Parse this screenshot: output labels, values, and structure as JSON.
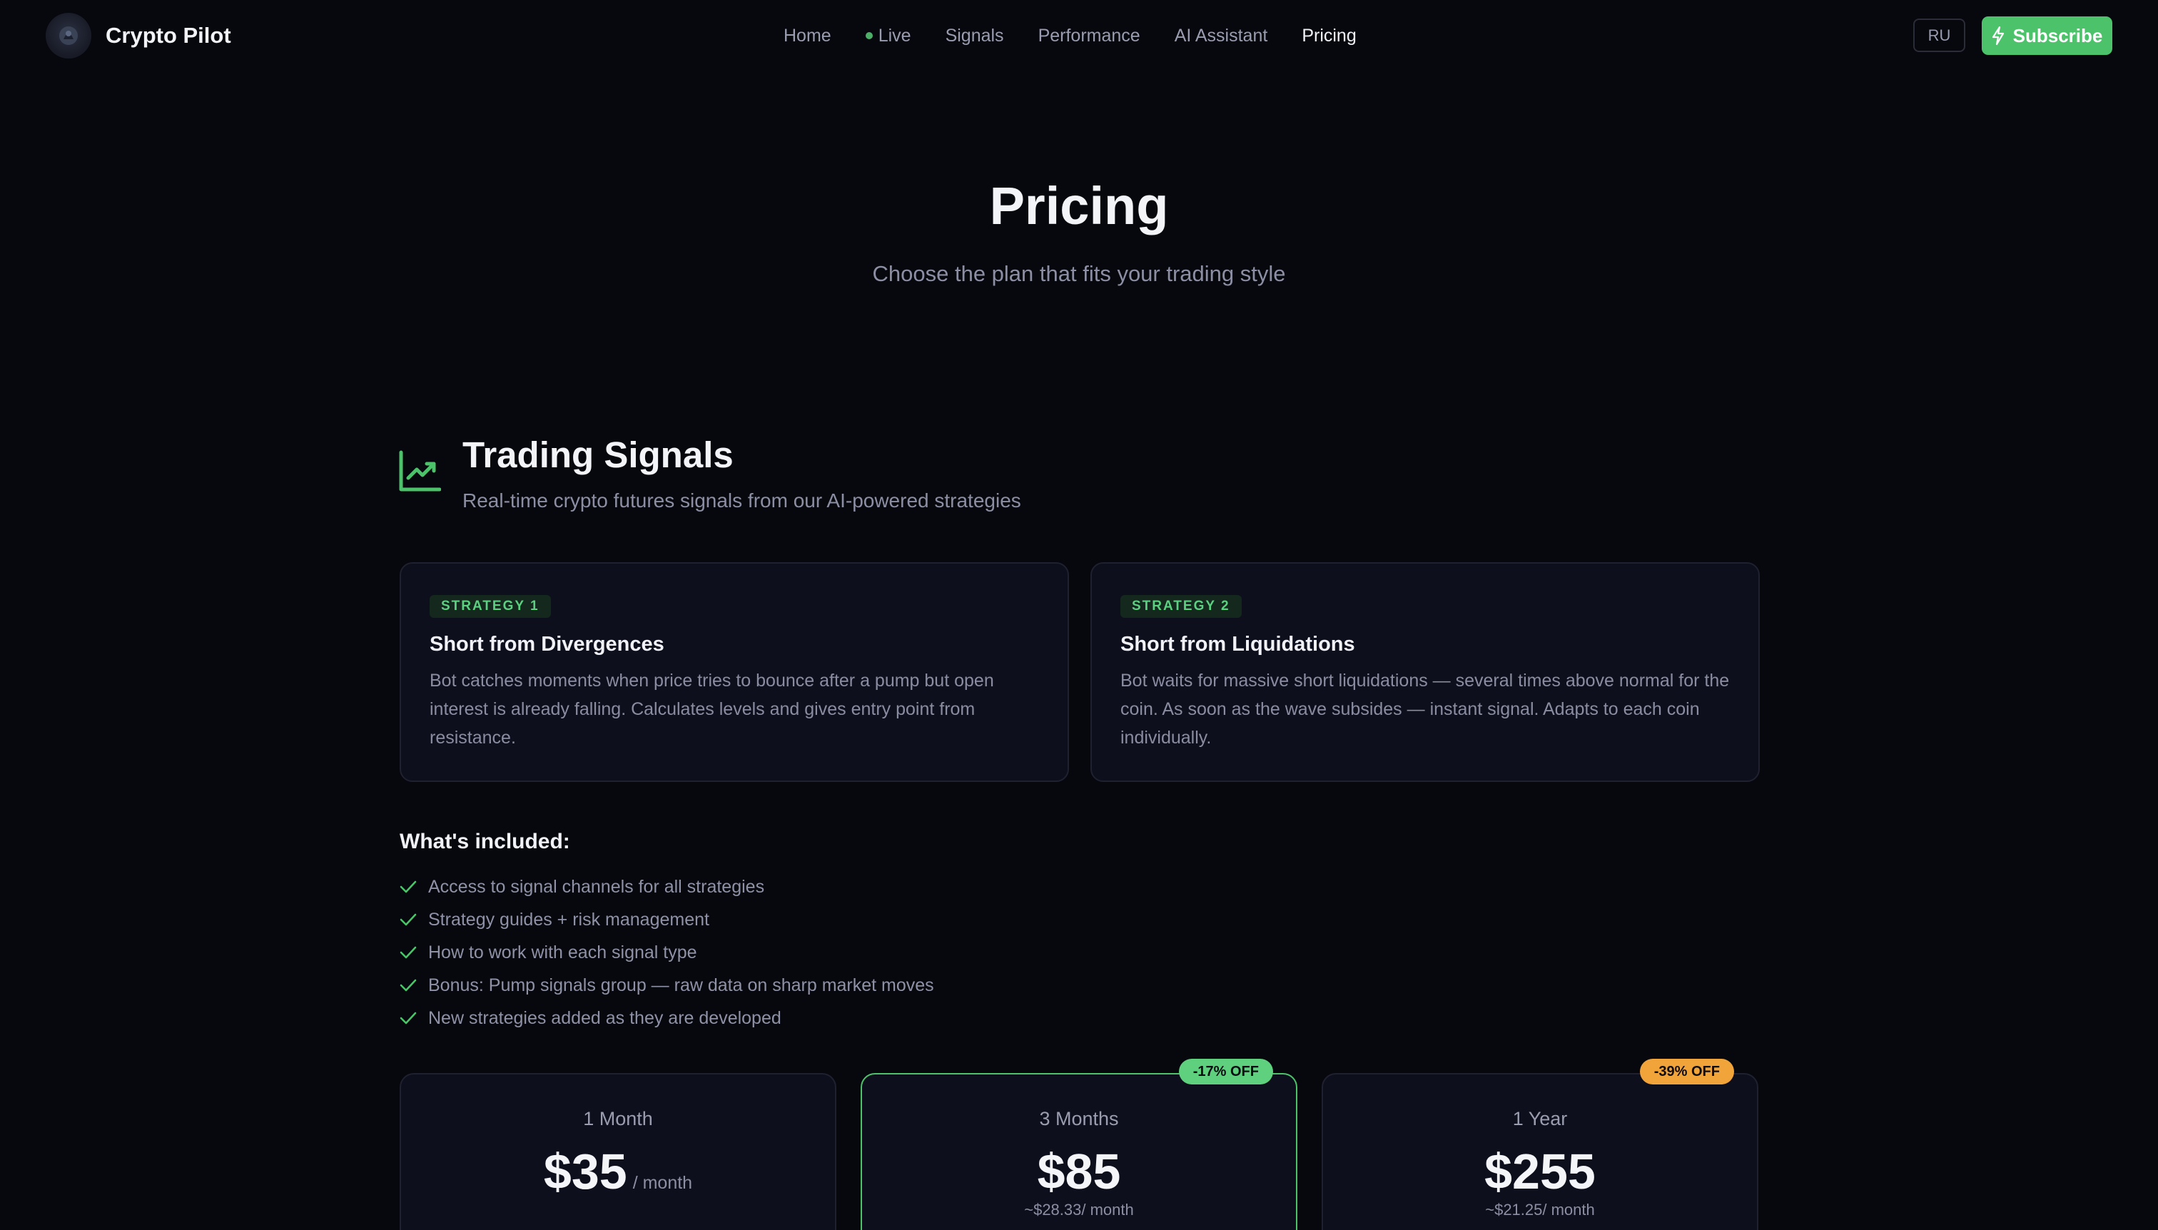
{
  "brand": {
    "name": "Crypto Pilot"
  },
  "nav": {
    "links": [
      {
        "label": "Home"
      },
      {
        "label": "Live"
      },
      {
        "label": "Signals"
      },
      {
        "label": "Performance"
      },
      {
        "label": "AI Assistant"
      },
      {
        "label": "Pricing"
      }
    ],
    "active": "Pricing",
    "language_label": "RU",
    "subscribe_label": "Subscribe"
  },
  "hero": {
    "title": "Pricing",
    "subtitle": "Choose the plan that fits your trading style"
  },
  "section": {
    "icon": "trending-up-icon",
    "title": "Trading Signals",
    "subtitle": "Real-time crypto futures signals from our AI-powered strategies"
  },
  "strategies": [
    {
      "tag": "STRATEGY 1",
      "title": "Short from Divergences",
      "description": "Bot catches moments when price tries to bounce after a pump but open interest is already falling. Calculates levels and gives entry point from resistance."
    },
    {
      "tag": "STRATEGY 2",
      "title": "Short from Liquidations",
      "description": "Bot waits for massive short liquidations — several times above normal for the coin. As soon as the wave subsides — instant signal. Adapts to each coin individually."
    }
  ],
  "included": {
    "title": "What's included:",
    "items": [
      "Access to signal channels for all strategies",
      "Strategy guides + risk management",
      "How to work with each signal type",
      "Bonus: Pump signals group — raw data on sharp market moves",
      "New strategies added as they are developed"
    ]
  },
  "plans": [
    {
      "name": "1 Month",
      "price": "$35",
      "per": "/ month"
    },
    {
      "name": "3 Months",
      "price": "$85",
      "per_month_equivalent": "~$28.33/ month",
      "badge": "-17% OFF"
    },
    {
      "name": "1 Year",
      "price": "$255",
      "per_month_equivalent": "~$21.25/ month",
      "badge": "-39% OFF"
    }
  ],
  "colors": {
    "background": "#07070e",
    "card": "#0e0f1c",
    "accent_green": "#4cc36a",
    "accent_orange": "#f0a43a",
    "muted_text": "#8c8fa3"
  }
}
